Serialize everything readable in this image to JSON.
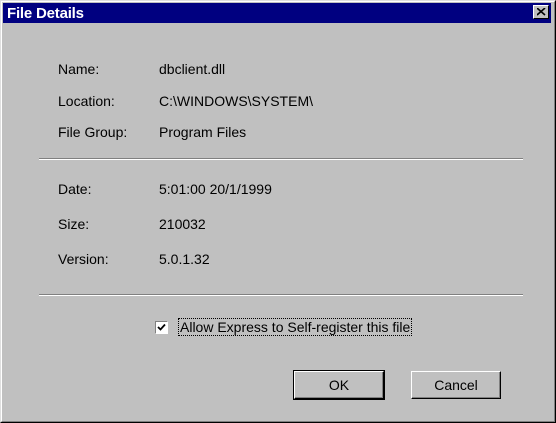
{
  "window": {
    "title": "File Details"
  },
  "details": [
    {
      "label": "Name:",
      "value": "dbclient.dll"
    },
    {
      "label": "Location:",
      "value": "C:\\WINDOWS\\SYSTEM\\"
    },
    {
      "label": "File Group:",
      "value": "Program Files"
    }
  ],
  "file_info": [
    {
      "label": "Date:",
      "value": "5:01:00  20/1/1999"
    },
    {
      "label": "Size:",
      "value": "210032"
    },
    {
      "label": "Version:",
      "value": "5.0.1.32"
    }
  ],
  "option": {
    "label": "Allow Express to Self-register this file",
    "checked": true
  },
  "buttons": {
    "ok": "OK",
    "cancel": "Cancel"
  }
}
